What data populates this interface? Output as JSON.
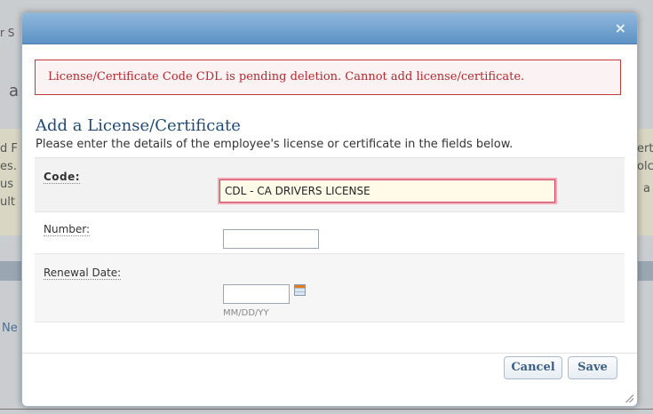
{
  "background_fragments": {
    "top_left": "r S",
    "left_a": "a",
    "left_lines": [
      "d F",
      "es.",
      "us",
      "ult"
    ],
    "right_lines": [
      "erta",
      "olc",
      "a"
    ],
    "link": "Ne"
  },
  "dialog": {
    "close_glyph": "×",
    "error_message": "License/Certificate Code CDL is pending deletion. Cannot add license/certificate.",
    "heading": "Add a License/Certificate",
    "instructions": "Please enter the details of the employee's license or certificate in the fields below.",
    "fields": {
      "code": {
        "label": "Code:",
        "value": "CDL - CA DRIVERS LICENSE"
      },
      "number": {
        "label": "Number:",
        "value": ""
      },
      "renewal_date": {
        "label": "Renewal Date:",
        "value": "",
        "hint": "MM/DD/YY",
        "icon": "calendar-icon"
      }
    },
    "buttons": {
      "cancel": "Cancel",
      "save": "Save"
    }
  }
}
